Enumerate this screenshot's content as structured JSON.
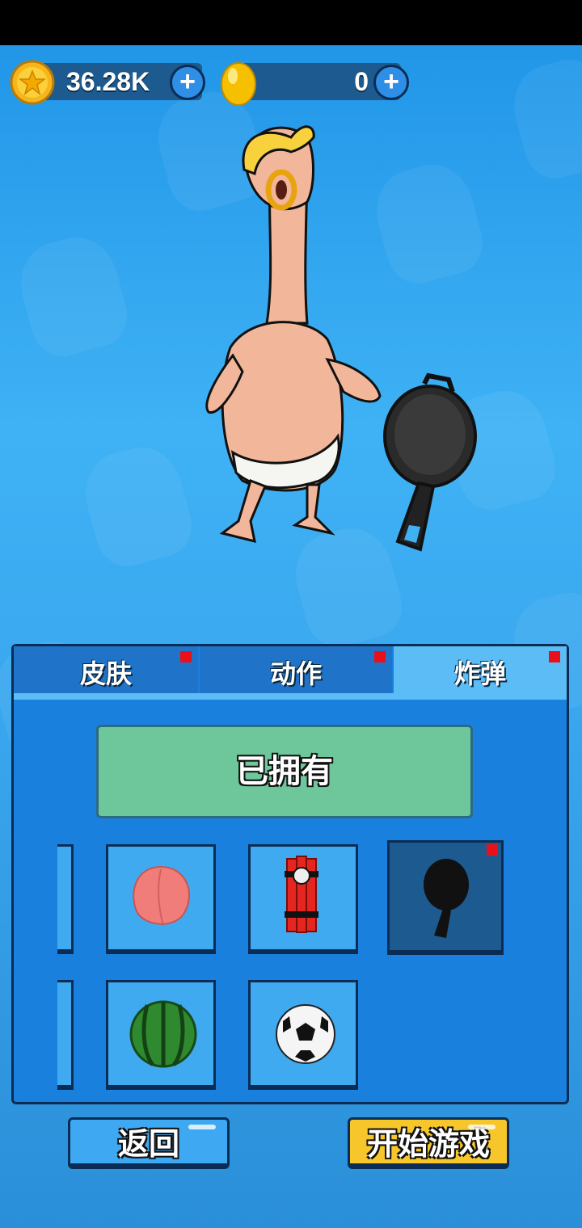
{
  "currency": {
    "gold": {
      "icon": "star-coin-icon",
      "value": "36.28K"
    },
    "egg": {
      "icon": "golden-egg-icon",
      "value": "0"
    },
    "plus_symbol": "+"
  },
  "character": {
    "name": "rubber-chicken-character",
    "held_item": "frying-pan-icon"
  },
  "tabs": [
    {
      "label": "皮肤",
      "active": false,
      "has_badge": true
    },
    {
      "label": "动作",
      "active": false,
      "has_badge": true
    },
    {
      "label": "炸弹",
      "active": true,
      "has_badge": true
    }
  ],
  "owned_label": "已拥有",
  "items": [
    {
      "icon": "peach-icon"
    },
    {
      "icon": "dynamite-icon"
    },
    {
      "icon": "frying-pan-icon",
      "selected": true,
      "has_badge": true
    },
    {
      "icon": "watermelon-icon"
    },
    {
      "icon": "soccer-ball-icon"
    }
  ],
  "buttons": {
    "back": "返回",
    "start": "开始游戏"
  },
  "colors": {
    "accent_yellow": "#f6c62a",
    "owned_green": "#6ec79a",
    "badge_red": "#e8101a",
    "panel_blue": "#1a80dd"
  }
}
